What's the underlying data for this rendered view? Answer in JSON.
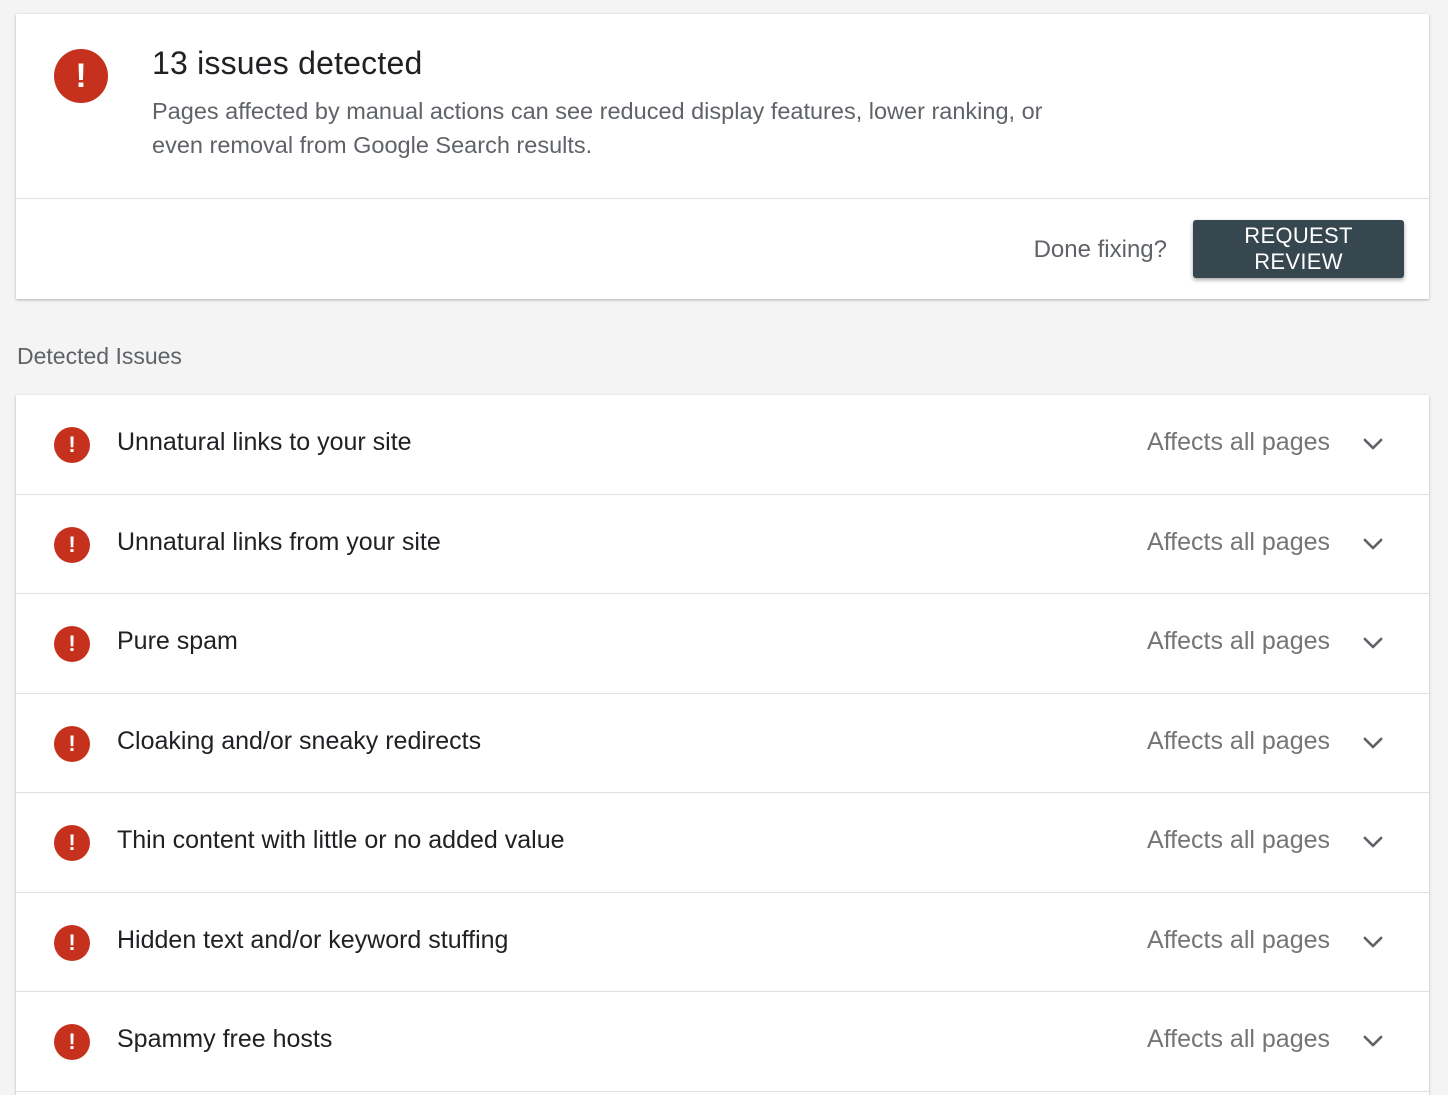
{
  "colors": {
    "alert_red": "#c5311d",
    "button_bg": "#37474f"
  },
  "summary": {
    "icon": "alert-exclamation-icon",
    "icon_glyph": "!",
    "title": "13 issues detected",
    "description": "Pages affected by manual actions can see reduced display features, lower ranking, or even removal from Google Search results.",
    "done_fixing_label": "Done fixing?",
    "request_review_label": "REQUEST REVIEW"
  },
  "section": {
    "label": "Detected Issues"
  },
  "issues": [
    {
      "label": "Unnatural links to your site",
      "scope": "Affects all pages"
    },
    {
      "label": "Unnatural links from your site",
      "scope": "Affects all pages"
    },
    {
      "label": "Pure spam",
      "scope": "Affects all pages"
    },
    {
      "label": "Cloaking and/or sneaky redirects",
      "scope": "Affects all pages"
    },
    {
      "label": "Thin content with little or no added value",
      "scope": "Affects all pages"
    },
    {
      "label": "Hidden text and/or keyword stuffing",
      "scope": "Affects all pages"
    },
    {
      "label": "Spammy free hosts",
      "scope": "Affects all pages"
    }
  ]
}
